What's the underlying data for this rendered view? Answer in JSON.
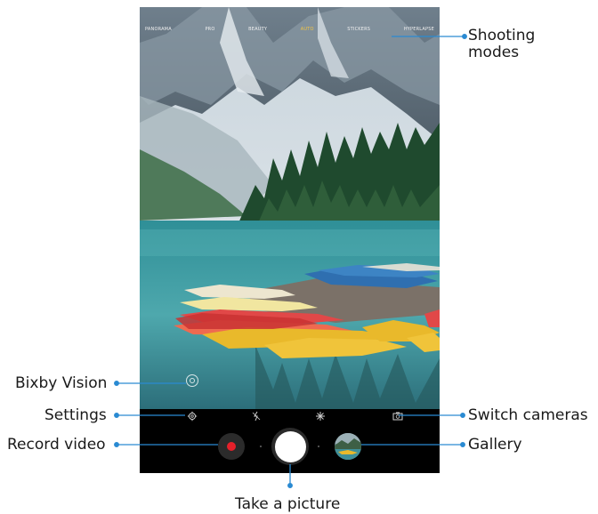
{
  "shooting_modes": [
    {
      "label": "PANORAMA",
      "active": false
    },
    {
      "label": "PRO",
      "active": false
    },
    {
      "label": "BEAUTY",
      "active": false
    },
    {
      "label": "AUTO",
      "active": true
    },
    {
      "label": "STICKERS",
      "active": false
    },
    {
      "label": "HYPERLAPSE",
      "active": false
    }
  ],
  "colors": {
    "active_mode": "#f4c542",
    "record": "#e5202a",
    "callout_line": "#2a8ad2"
  },
  "icons": {
    "bixby": "bixby-vision-icon",
    "settings": "gear-icon",
    "flash": "flash-off-icon",
    "effects": "sparkle-icon",
    "switch": "switch-camera-icon"
  },
  "callouts": {
    "shooting_modes": "Shooting\nmodes",
    "bixby_vision": "Bixby Vision",
    "settings": "Settings",
    "record_video": "Record video",
    "take_picture": "Take a picture",
    "switch_cameras": "Switch cameras",
    "gallery": "Gallery"
  }
}
